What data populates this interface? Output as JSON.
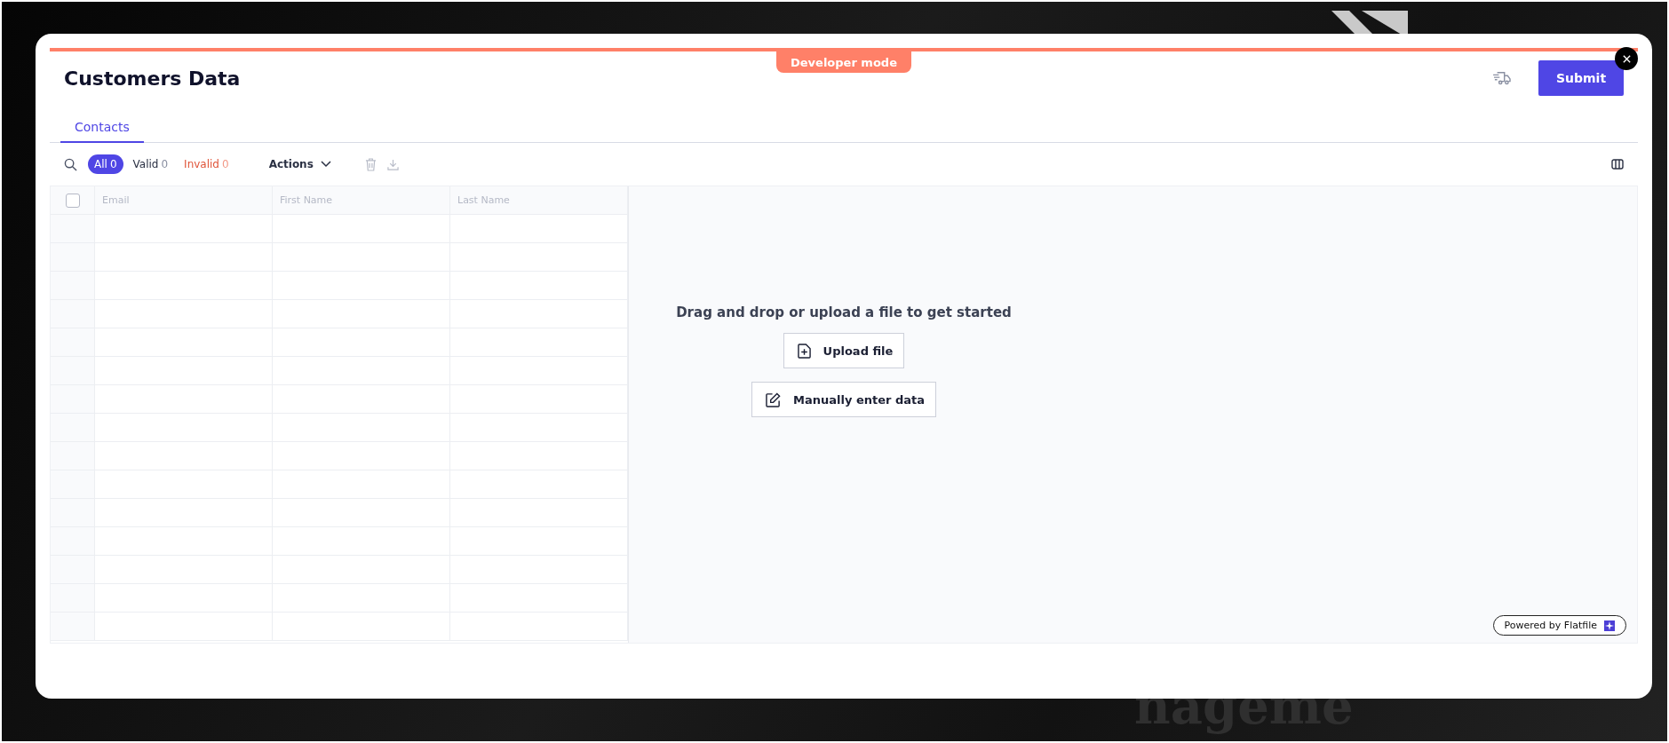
{
  "backdrop": {
    "heading_fragment": "nageme"
  },
  "banner": {
    "label": "Developer mode"
  },
  "header": {
    "title": "Customers Data",
    "submit": "Submit"
  },
  "tabs": [
    {
      "label": "Contacts",
      "selected": true
    }
  ],
  "filters": [
    {
      "label": "All",
      "count": "0",
      "selected": true,
      "kind": "all"
    },
    {
      "label": "Valid",
      "count": "0",
      "selected": false,
      "kind": "valid"
    },
    {
      "label": "Invalid",
      "count": "0",
      "selected": false,
      "kind": "invalid"
    }
  ],
  "actions_menu": {
    "label": "Actions"
  },
  "table": {
    "select_all_checked": false,
    "columns": [
      "Email",
      "First Name",
      "Last Name"
    ]
  },
  "empty_state": {
    "message": "Drag and drop or upload a file to get started",
    "buttons": [
      {
        "label": "Upload file",
        "kind": "upload"
      },
      {
        "label": "Manually enter data",
        "kind": "manual"
      }
    ]
  },
  "footer": {
    "badge": "Powered by Flatfile"
  }
}
